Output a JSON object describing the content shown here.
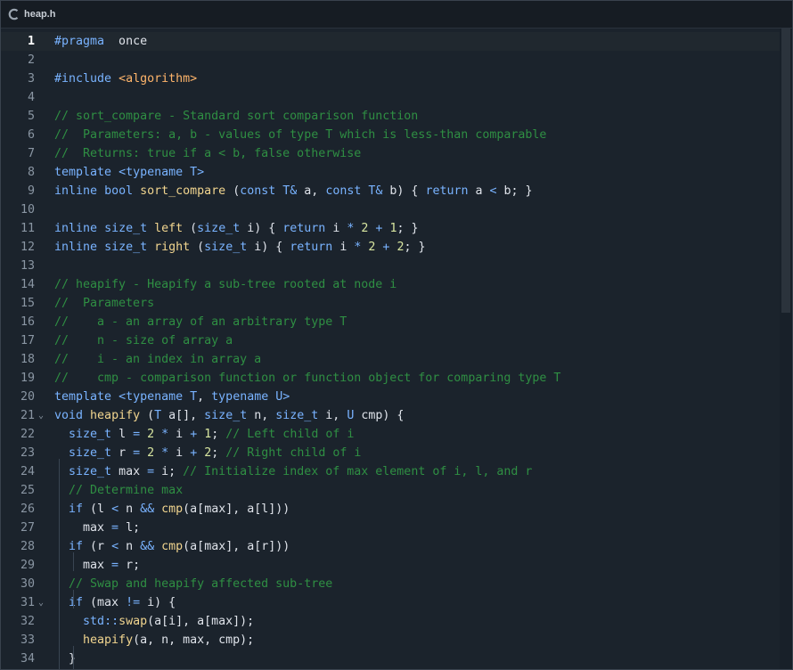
{
  "tab": {
    "title": "heap.h",
    "icon": "c-file-icon"
  },
  "editor": {
    "current_line": 1,
    "lines": [
      {
        "n": "1",
        "segs": [
          [
            "k",
            "#pragma"
          ],
          [
            "",
            "  once"
          ]
        ]
      },
      {
        "n": "2",
        "segs": []
      },
      {
        "n": "3",
        "segs": [
          [
            "k",
            "#include"
          ],
          [
            "",
            " "
          ],
          [
            "s",
            "<algorithm>"
          ]
        ]
      },
      {
        "n": "4",
        "segs": []
      },
      {
        "n": "5",
        "segs": [
          [
            "c",
            "// sort_compare - Standard sort comparison function"
          ]
        ]
      },
      {
        "n": "6",
        "segs": [
          [
            "c",
            "//  Parameters: a, b - values of type T which is less-than comparable"
          ]
        ]
      },
      {
        "n": "7",
        "segs": [
          [
            "c",
            "//  Returns: true if a < b, false otherwise"
          ]
        ]
      },
      {
        "n": "8",
        "segs": [
          [
            "k",
            "template"
          ],
          [
            "",
            " "
          ],
          [
            "o",
            "<"
          ],
          [
            "k",
            "typename"
          ],
          [
            "",
            " "
          ],
          [
            "t",
            "T"
          ],
          [
            "o",
            ">"
          ]
        ]
      },
      {
        "n": "9",
        "segs": [
          [
            "k",
            "inline"
          ],
          [
            "",
            " "
          ],
          [
            "k",
            "bool"
          ],
          [
            "",
            " "
          ],
          [
            "f",
            "sort_compare"
          ],
          [
            "",
            " ("
          ],
          [
            "k",
            "const"
          ],
          [
            "",
            " "
          ],
          [
            "t",
            "T"
          ],
          [
            "o",
            "&"
          ],
          [
            "",
            " a, "
          ],
          [
            "k",
            "const"
          ],
          [
            "",
            " "
          ],
          [
            "t",
            "T"
          ],
          [
            "o",
            "&"
          ],
          [
            "",
            " b) { "
          ],
          [
            "k",
            "return"
          ],
          [
            "",
            " a "
          ],
          [
            "o",
            "<"
          ],
          [
            "",
            " b; }"
          ]
        ]
      },
      {
        "n": "10",
        "segs": []
      },
      {
        "n": "11",
        "segs": [
          [
            "k",
            "inline"
          ],
          [
            "",
            " "
          ],
          [
            "t",
            "size_t"
          ],
          [
            "",
            " "
          ],
          [
            "f",
            "left"
          ],
          [
            "",
            " ("
          ],
          [
            "t",
            "size_t"
          ],
          [
            "",
            " i) { "
          ],
          [
            "k",
            "return"
          ],
          [
            "",
            " i "
          ],
          [
            "o",
            "*"
          ],
          [
            "",
            " "
          ],
          [
            "n",
            "2"
          ],
          [
            "",
            " "
          ],
          [
            "o",
            "+"
          ],
          [
            "",
            " "
          ],
          [
            "n",
            "1"
          ],
          [
            "",
            "; }"
          ]
        ]
      },
      {
        "n": "12",
        "segs": [
          [
            "k",
            "inline"
          ],
          [
            "",
            " "
          ],
          [
            "t",
            "size_t"
          ],
          [
            "",
            " "
          ],
          [
            "f",
            "right"
          ],
          [
            "",
            " ("
          ],
          [
            "t",
            "size_t"
          ],
          [
            "",
            " i) { "
          ],
          [
            "k",
            "return"
          ],
          [
            "",
            " i "
          ],
          [
            "o",
            "*"
          ],
          [
            "",
            " "
          ],
          [
            "n",
            "2"
          ],
          [
            "",
            " "
          ],
          [
            "o",
            "+"
          ],
          [
            "",
            " "
          ],
          [
            "n",
            "2"
          ],
          [
            "",
            "; }"
          ]
        ]
      },
      {
        "n": "13",
        "segs": []
      },
      {
        "n": "14",
        "segs": [
          [
            "c",
            "// heapify - Heapify a sub-tree rooted at node i"
          ]
        ]
      },
      {
        "n": "15",
        "segs": [
          [
            "c",
            "//  Parameters"
          ]
        ]
      },
      {
        "n": "16",
        "segs": [
          [
            "c",
            "//    a - an array of an arbitrary type T"
          ]
        ]
      },
      {
        "n": "17",
        "segs": [
          [
            "c",
            "//    n - size of array a"
          ]
        ]
      },
      {
        "n": "18",
        "segs": [
          [
            "c",
            "//    i - an index in array a"
          ]
        ]
      },
      {
        "n": "19",
        "segs": [
          [
            "c",
            "//    cmp - comparison function or function object for comparing type T"
          ]
        ]
      },
      {
        "n": "20",
        "segs": [
          [
            "k",
            "template"
          ],
          [
            "",
            " "
          ],
          [
            "o",
            "<"
          ],
          [
            "k",
            "typename"
          ],
          [
            "",
            " "
          ],
          [
            "t",
            "T"
          ],
          [
            "",
            ", "
          ],
          [
            "k",
            "typename"
          ],
          [
            "",
            " "
          ],
          [
            "t",
            "U"
          ],
          [
            "o",
            ">"
          ]
        ]
      },
      {
        "n": "21",
        "fold": true,
        "segs": [
          [
            "k",
            "void"
          ],
          [
            "",
            " "
          ],
          [
            "f",
            "heapify"
          ],
          [
            "",
            " ("
          ],
          [
            "t",
            "T"
          ],
          [
            "",
            " a[], "
          ],
          [
            "t",
            "size_t"
          ],
          [
            "",
            " n, "
          ],
          [
            "t",
            "size_t"
          ],
          [
            "",
            " i, "
          ],
          [
            "t",
            "U"
          ],
          [
            "",
            " cmp) {"
          ]
        ]
      },
      {
        "n": "22",
        "segs": [
          [
            "",
            "  "
          ],
          [
            "t",
            "size_t"
          ],
          [
            "",
            " l "
          ],
          [
            "o",
            "="
          ],
          [
            "",
            " "
          ],
          [
            "n",
            "2"
          ],
          [
            "",
            " "
          ],
          [
            "o",
            "*"
          ],
          [
            "",
            " i "
          ],
          [
            "o",
            "+"
          ],
          [
            "",
            " "
          ],
          [
            "n",
            "1"
          ],
          [
            "",
            "; "
          ],
          [
            "c",
            "// Left child of i"
          ]
        ]
      },
      {
        "n": "23",
        "segs": [
          [
            "",
            "  "
          ],
          [
            "t",
            "size_t"
          ],
          [
            "",
            " r "
          ],
          [
            "o",
            "="
          ],
          [
            "",
            " "
          ],
          [
            "n",
            "2"
          ],
          [
            "",
            " "
          ],
          [
            "o",
            "*"
          ],
          [
            "",
            " i "
          ],
          [
            "o",
            "+"
          ],
          [
            "",
            " "
          ],
          [
            "n",
            "2"
          ],
          [
            "",
            "; "
          ],
          [
            "c",
            "// Right child of i"
          ]
        ]
      },
      {
        "n": "24",
        "segs": [
          [
            "",
            "  "
          ],
          [
            "t",
            "size_t"
          ],
          [
            "",
            " max "
          ],
          [
            "o",
            "="
          ],
          [
            "",
            " i; "
          ],
          [
            "c",
            "// Initialize index of max element of i, l, and r"
          ]
        ]
      },
      {
        "n": "25",
        "segs": [
          [
            "",
            "  "
          ],
          [
            "c",
            "// Determine max"
          ]
        ]
      },
      {
        "n": "26",
        "segs": [
          [
            "",
            "  "
          ],
          [
            "k",
            "if"
          ],
          [
            "",
            " (l "
          ],
          [
            "o",
            "<"
          ],
          [
            "",
            " n "
          ],
          [
            "o",
            "&&"
          ],
          [
            "",
            " "
          ],
          [
            "f",
            "cmp"
          ],
          [
            "",
            "(a[max], a[l]))"
          ]
        ]
      },
      {
        "n": "27",
        "segs": [
          [
            "",
            "    max "
          ],
          [
            "o",
            "="
          ],
          [
            "",
            " l;"
          ]
        ]
      },
      {
        "n": "28",
        "segs": [
          [
            "",
            "  "
          ],
          [
            "k",
            "if"
          ],
          [
            "",
            " (r "
          ],
          [
            "o",
            "<"
          ],
          [
            "",
            " n "
          ],
          [
            "o",
            "&&"
          ],
          [
            "",
            " "
          ],
          [
            "f",
            "cmp"
          ],
          [
            "",
            "(a[max], a[r]))"
          ]
        ]
      },
      {
        "n": "29",
        "segs": [
          [
            "",
            "    max "
          ],
          [
            "o",
            "="
          ],
          [
            "",
            " r;"
          ]
        ]
      },
      {
        "n": "30",
        "segs": [
          [
            "",
            "  "
          ],
          [
            "c",
            "// Swap and heapify affected sub-tree"
          ]
        ]
      },
      {
        "n": "31",
        "fold": true,
        "segs": [
          [
            "",
            "  "
          ],
          [
            "k",
            "if"
          ],
          [
            "",
            " (max "
          ],
          [
            "o",
            "!="
          ],
          [
            "",
            " i) {"
          ]
        ]
      },
      {
        "n": "32",
        "segs": [
          [
            "",
            "    "
          ],
          [
            "t",
            "std"
          ],
          [
            "o",
            "::"
          ],
          [
            "f",
            "swap"
          ],
          [
            "",
            "(a[i], a[max]);"
          ]
        ]
      },
      {
        "n": "33",
        "segs": [
          [
            "",
            "    "
          ],
          [
            "f",
            "heapify"
          ],
          [
            "",
            "(a, n, max, cmp);"
          ]
        ]
      },
      {
        "n": "34",
        "segs": [
          [
            "",
            "  }"
          ]
        ]
      }
    ]
  }
}
